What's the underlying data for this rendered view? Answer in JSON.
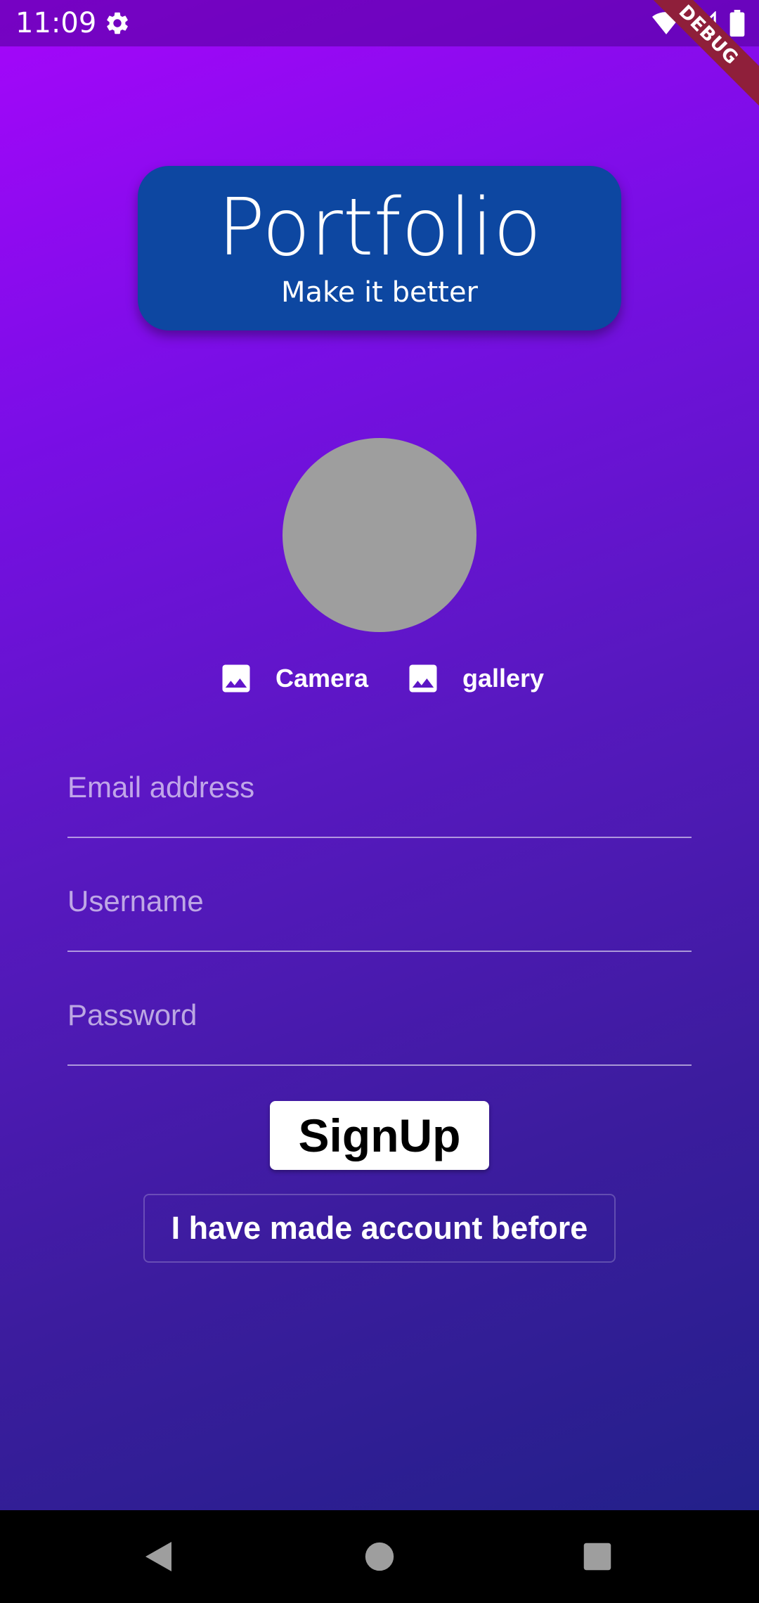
{
  "status_bar": {
    "time": "11:09",
    "icons": [
      "gear-icon",
      "wifi-icon",
      "signal-icon",
      "battery-icon"
    ]
  },
  "debug_banner": "DEBUG",
  "header": {
    "title": "Portfolio",
    "subtitle": "Make it better"
  },
  "image_picker": {
    "camera_label": "Camera",
    "gallery_label": "gallery"
  },
  "form": {
    "email_placeholder": "Email address",
    "username_placeholder": "Username",
    "password_placeholder": "Password"
  },
  "actions": {
    "signup_label": "SignUp",
    "login_label": "I have made account before"
  },
  "navigation": [
    "back-icon",
    "home-icon",
    "recents-icon"
  ],
  "colors": {
    "title_card": "#0d47a1",
    "gradient_top": "#a606fb",
    "gradient_bottom": "#23208a",
    "avatar": "#9e9e9e",
    "debug_banner": "#8f1f3a"
  }
}
